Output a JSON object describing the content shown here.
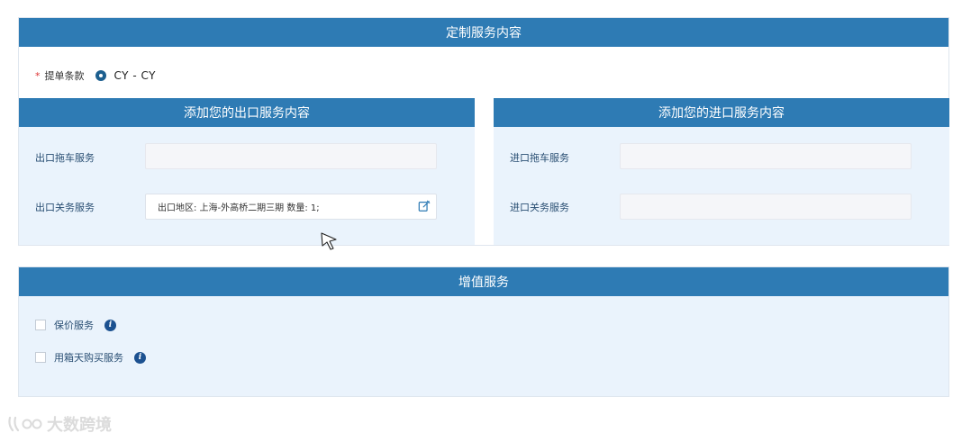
{
  "header": {
    "title": "定制服务内容"
  },
  "terms": {
    "required_mark": "*",
    "label": "提单条款",
    "value": "CY - CY"
  },
  "export_panel": {
    "title": "添加您的出口服务内容",
    "trucking_label": "出口拖车服务",
    "trucking_value": "",
    "customs_label": "出口关务服务",
    "customs_value": "出口地区: 上海-外高桥二期三期  数量: 1;"
  },
  "import_panel": {
    "title": "添加您的进口服务内容",
    "trucking_label": "进口拖车服务",
    "trucking_value": "",
    "customs_label": "进口关务服务",
    "customs_value": ""
  },
  "value_added": {
    "title": "增值服务",
    "items": [
      {
        "label": "保价服务",
        "checked": false
      },
      {
        "label": "用箱天购买服务",
        "checked": false
      }
    ]
  },
  "watermark": {
    "text": "大数跨境"
  },
  "colors": {
    "accent": "#2e7bb4",
    "panel_bg": "#eaf3fc",
    "info": "#1c5190"
  }
}
